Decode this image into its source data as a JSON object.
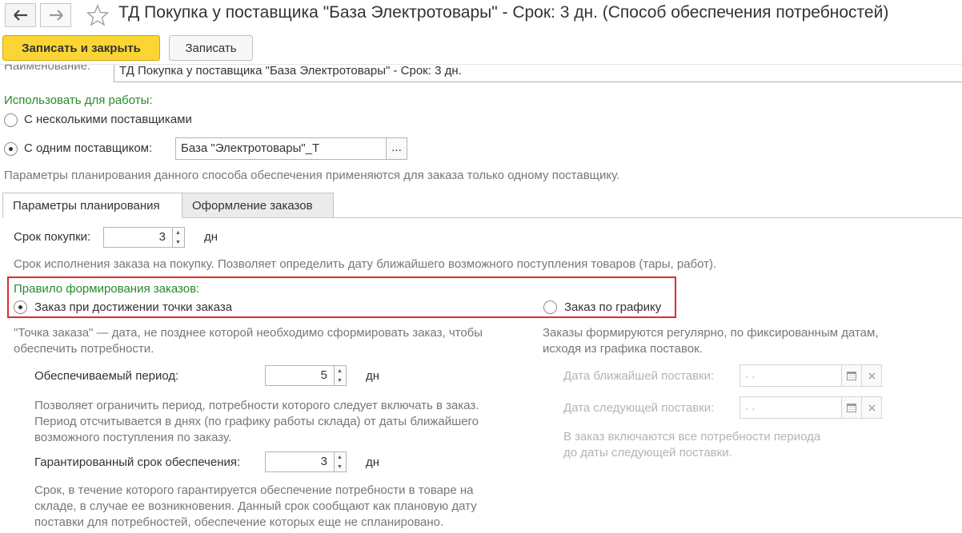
{
  "window": {
    "title": "ТД Покупка у поставщика \"База Электротовары\" - Срок: 3 дн. (Способ обеспечения потребностей)"
  },
  "toolbar": {
    "save_close_label": "Записать и закрыть",
    "save_label": "Записать"
  },
  "name_field": {
    "label": "Наименование:",
    "value": "ТД Покупка у поставщика \"База Электротовары\" - Срок: 3 дн."
  },
  "use_for_work": {
    "label": "Использовать для работы:",
    "option_multiple": "С несколькими поставщиками",
    "option_single": "С одним поставщиком:",
    "supplier_value": "База \"Электротовары\"_Т",
    "select_button": "...",
    "hint": "Параметры планирования данного способа обеспечения применяются для заказа только одному поставщику."
  },
  "tabs": [
    {
      "label": "Параметры планирования"
    },
    {
      "label": "Оформление заказов"
    }
  ],
  "purchase_term": {
    "label": "Срок покупки:",
    "value": "3",
    "unit": "дн",
    "hint": "Срок исполнения заказа на покупку. Позволяет определить дату ближайшего возможного поступления товаров (тары, работ)."
  },
  "order_rule": {
    "label": "Правило формирования заказов:",
    "option_point": "Заказ при достижении точки заказа",
    "option_schedule": "Заказ по графику"
  },
  "left_column": {
    "hint_line1": "\"Точка заказа\" — дата, не позднее которой необходимо сформировать заказ, чтобы",
    "hint_line2": "обеспечить потребности.",
    "period_label": "Обеспечиваемый период:",
    "period_value": "5",
    "period_unit": "дн",
    "period_hint_line1": "Позволяет ограничить период, потребности которого следует включать в заказ.",
    "period_hint_line2": "Период отсчитывается в днях (по графику работы склада) от даты ближайшего",
    "period_hint_line3": "возможного поступления по заказу.",
    "guarantee_label": "Гарантированный срок обеспечения:",
    "guarantee_value": "3",
    "guarantee_unit": "дн",
    "guarantee_hint_line1": "Срок, в течение которого гарантируется обеспечение потребности в товаре на",
    "guarantee_hint_line2": "складе, в случае ее возникновения. Данный срок сообщают как плановую дату",
    "guarantee_hint_line3": "поставки для потребностей, обеспечение которых еще не спланировано."
  },
  "right_column": {
    "hint_line1": "Заказы формируются регулярно, по фиксированным датам,",
    "hint_line2": "исходя из графика поставок.",
    "nearest_label": "Дата ближайшей поставки:",
    "nearest_value": " .  .",
    "next_label": "Дата следующей поставки:",
    "next_value": " .  .",
    "bottom_hint_line1": "В заказ включаются все потребности периода",
    "bottom_hint_line2": "до даты следующей поставки."
  },
  "icons": {
    "back": "arrow-left-icon",
    "forward": "arrow-right-icon",
    "favorite": "star-icon",
    "calendar": "calendar-icon",
    "clear": "clear-icon",
    "spin_up": "chevron-up-icon",
    "spin_down": "chevron-down-icon"
  },
  "colors": {
    "primary_button": "#fbd533",
    "group_label": "#2a8a2a",
    "highlight_frame": "#e02b2b"
  }
}
